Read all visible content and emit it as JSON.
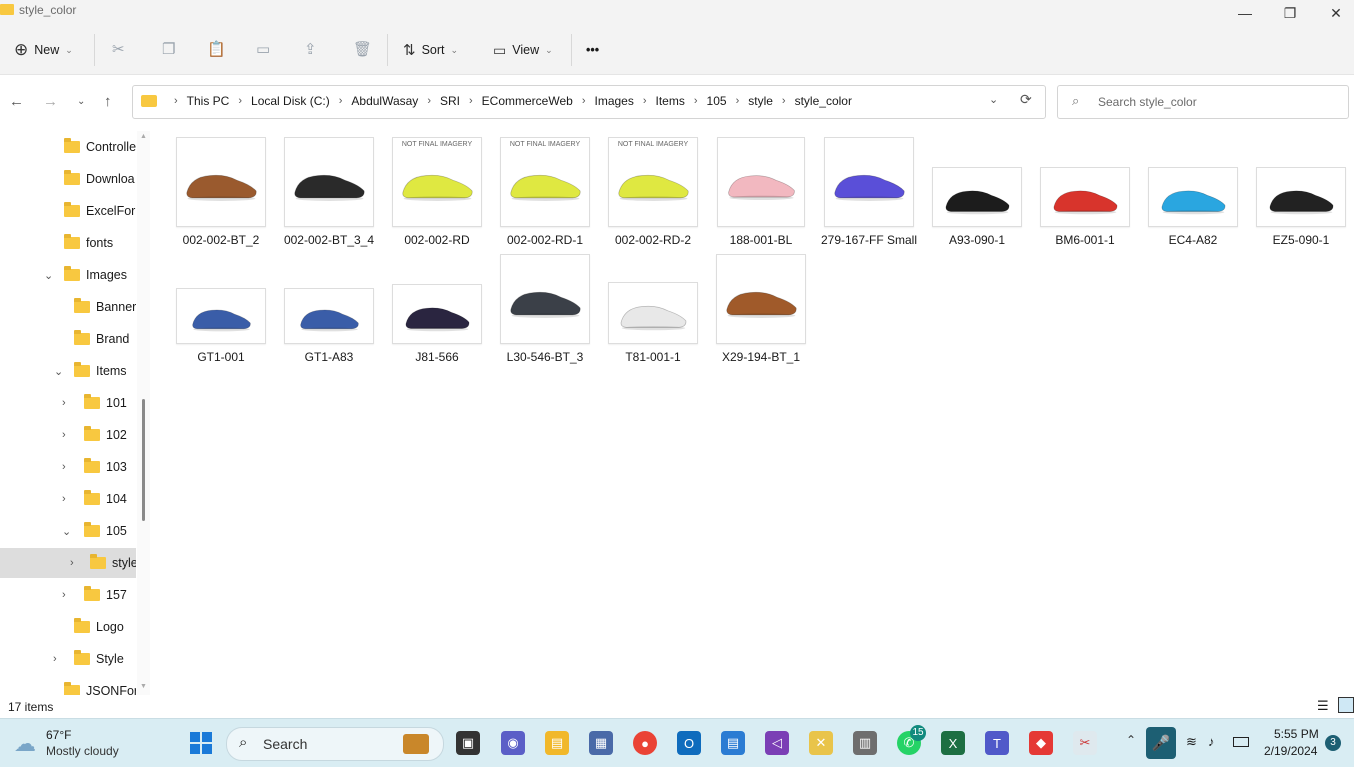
{
  "window": {
    "title": "style_color",
    "minimize_label": "—",
    "restore_label": "❐",
    "close_label": "✕"
  },
  "toolbar": {
    "new_label": "New",
    "sort_label": "Sort",
    "view_label": "View",
    "more_label": "•••"
  },
  "address": {
    "crumbs": [
      "This PC",
      "Local Disk (C:)",
      "AbdulWasay",
      "SRI",
      "ECommerceWeb",
      "Images",
      "Items",
      "105",
      "style",
      "style_color"
    ]
  },
  "search": {
    "placeholder": "Search style_color"
  },
  "sidebar": {
    "items": [
      {
        "label": "Controlle"
      },
      {
        "label": "Downloa"
      },
      {
        "label": "ExcelForr"
      },
      {
        "label": "fonts"
      },
      {
        "label": "Images"
      },
      {
        "label": "Banner"
      },
      {
        "label": "Brand"
      },
      {
        "label": "Items"
      },
      {
        "label": "101"
      },
      {
        "label": "102"
      },
      {
        "label": "103"
      },
      {
        "label": "104"
      },
      {
        "label": "105"
      },
      {
        "label": "style"
      },
      {
        "label": "157"
      },
      {
        "label": "Logo"
      },
      {
        "label": "Style"
      },
      {
        "label": "JSONForr"
      }
    ]
  },
  "files": [
    {
      "name": "002-002-BT_2",
      "color": "#9a5a2e"
    },
    {
      "name": "002-002-BT_3_4",
      "color": "#2a2a2a"
    },
    {
      "name": "002-002-RD",
      "color": "#dfe841",
      "watermark": "NOT FINAL IMAGERY"
    },
    {
      "name": "002-002-RD-1",
      "color": "#dfe841",
      "watermark": "NOT FINAL IMAGERY"
    },
    {
      "name": "002-002-RD-2",
      "color": "#dfe841",
      "watermark": "NOT FINAL IMAGERY"
    },
    {
      "name": "188-001-BL",
      "color": "#f2b8c0"
    },
    {
      "name": "279-167-FF Small",
      "color": "#5a4fd8"
    },
    {
      "name": "A93-090-1",
      "color": "#1c1c1c"
    },
    {
      "name": "BM6-001-1",
      "color": "#d8342c"
    },
    {
      "name": "EC4-A82",
      "color": "#2aa6e0"
    },
    {
      "name": "EZ5-090-1",
      "color": "#222222"
    },
    {
      "name": "GT1-001",
      "color": "#3a5da8"
    },
    {
      "name": "GT1-A83",
      "color": "#3a5da8"
    },
    {
      "name": "J81-566",
      "color": "#2a2540"
    },
    {
      "name": "L30-546-BT_3",
      "color": "#3b4048"
    },
    {
      "name": "T81-001-1",
      "color": "#e8e8e8"
    },
    {
      "name": "X29-194-BT_1",
      "color": "#a05a2a"
    }
  ],
  "status": {
    "count_label": "17 items"
  },
  "taskbar": {
    "weather_temp": "67°F",
    "weather_desc": "Mostly cloudy",
    "search_label": "Search",
    "whatsapp_badge": "15",
    "time": "5:55 PM",
    "date": "2/19/2024",
    "notifications": "3"
  }
}
